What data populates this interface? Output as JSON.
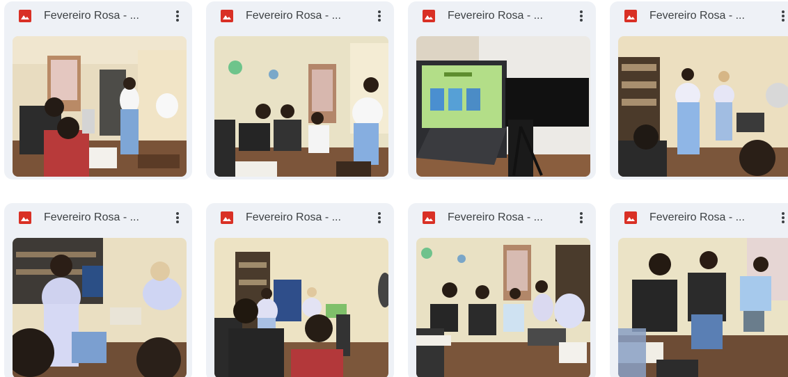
{
  "files": [
    {
      "title": "Fevereiro Rosa - ...",
      "icon": "image-file-icon",
      "menu_icon": "more-vert-icon"
    },
    {
      "title": "Fevereiro Rosa - ...",
      "icon": "image-file-icon",
      "menu_icon": "more-vert-icon"
    },
    {
      "title": "Fevereiro Rosa - ...",
      "icon": "image-file-icon",
      "menu_icon": "more-vert-icon"
    },
    {
      "title": "Fevereiro Rosa - ...",
      "icon": "image-file-icon",
      "menu_icon": "more-vert-icon"
    },
    {
      "title": "Fevereiro Rosa - ...",
      "icon": "image-file-icon",
      "menu_icon": "more-vert-icon"
    },
    {
      "title": "Fevereiro Rosa - ...",
      "icon": "image-file-icon",
      "menu_icon": "more-vert-icon"
    },
    {
      "title": "Fevereiro Rosa - ...",
      "icon": "image-file-icon",
      "menu_icon": "more-vert-icon"
    },
    {
      "title": "Fevereiro Rosa - ...",
      "icon": "image-file-icon",
      "menu_icon": "more-vert-icon"
    }
  ],
  "colors": {
    "card_background": "#eef1f6",
    "image_icon": "#d93025",
    "title_text": "#3c4043"
  }
}
